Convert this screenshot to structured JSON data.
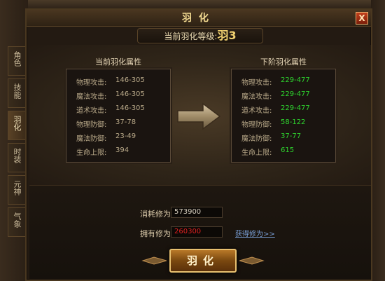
{
  "window": {
    "title": "羽化",
    "close_label": "X"
  },
  "level": {
    "label": "当前羽化等级:",
    "value": "羽3"
  },
  "tabs": [
    {
      "label": "角色"
    },
    {
      "label": "技能"
    },
    {
      "label": "羽化"
    },
    {
      "label": "时装"
    },
    {
      "label": "元神"
    },
    {
      "label": "气象"
    }
  ],
  "current": {
    "title": "当前羽化属性",
    "rows": [
      {
        "label": "物理攻击:",
        "value": "146-305"
      },
      {
        "label": "魔法攻击:",
        "value": "146-305"
      },
      {
        "label": "道术攻击:",
        "value": "146-305"
      },
      {
        "label": "物理防御:",
        "value": "37-78"
      },
      {
        "label": "魔法防御:",
        "value": "23-49"
      },
      {
        "label": "生命上限:",
        "value": "394"
      }
    ]
  },
  "next": {
    "title": "下阶羽化属性",
    "rows": [
      {
        "label": "物理攻击:",
        "value": "229-477"
      },
      {
        "label": "魔法攻击:",
        "value": "229-477"
      },
      {
        "label": "道术攻击:",
        "value": "229-477"
      },
      {
        "label": "物理防御:",
        "value": "58-122"
      },
      {
        "label": "魔法防御:",
        "value": "37-77"
      },
      {
        "label": "生命上限:",
        "value": "615"
      }
    ]
  },
  "cost": {
    "label": "消耗修为:",
    "value": "573900"
  },
  "owned": {
    "label": "拥有修为:",
    "value": "260300",
    "link": "获得修为>>"
  },
  "action": {
    "label": "羽化"
  },
  "colors": {
    "next_value": "#2ed42e",
    "owned_value": "#e02020",
    "title": "#f0d890"
  }
}
